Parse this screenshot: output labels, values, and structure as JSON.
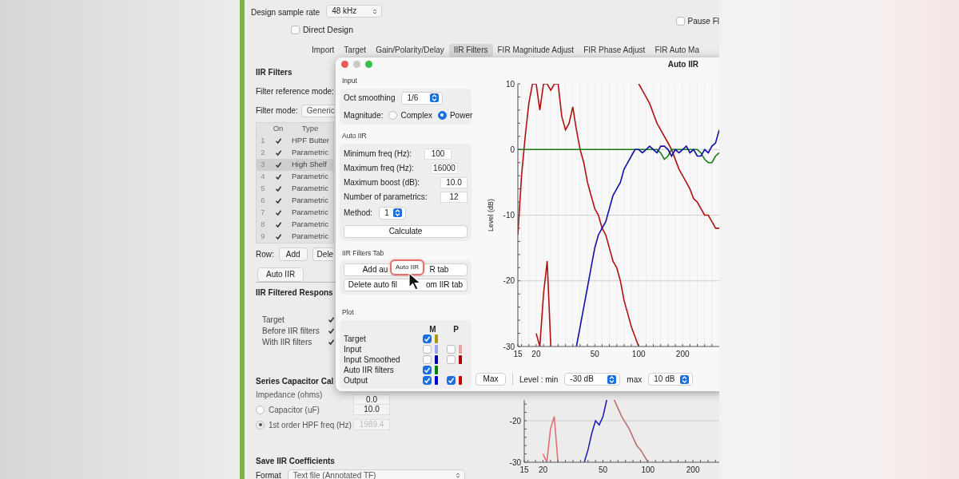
{
  "main_window": {
    "sample_rate": {
      "label": "Design sample rate",
      "value": "48 kHz"
    },
    "pause": {
      "label": "Pause Fl",
      "checked": false
    },
    "direct_design": {
      "label": "Direct Design",
      "checked": false
    },
    "tabs": [
      {
        "label": "Import",
        "selected": false
      },
      {
        "label": "Target",
        "selected": false
      },
      {
        "label": "Gain/Polarity/Delay",
        "selected": false
      },
      {
        "label": "IIR Filters",
        "selected": true
      },
      {
        "label": "FIR Magnitude Adjust",
        "selected": false
      },
      {
        "label": "FIR Phase Adjust",
        "selected": false
      },
      {
        "label": "FIR Auto Ma",
        "selected": false
      }
    ],
    "iir_panel": {
      "title": "IIR Filters",
      "reference_mode_label": "Filter reference mode:",
      "filter_mode_label": "Filter mode:",
      "filter_mode_value": "Generic",
      "table": {
        "columns": [
          "On",
          "Type"
        ],
        "rows": [
          {
            "index": "1",
            "on": true,
            "type": "HPF Butter",
            "selected": false
          },
          {
            "index": "2",
            "on": true,
            "type": "Parametric",
            "selected": false
          },
          {
            "index": "3",
            "on": true,
            "type": "High Shelf",
            "selected": true
          },
          {
            "index": "4",
            "on": true,
            "type": "Parametric",
            "selected": false
          },
          {
            "index": "5",
            "on": true,
            "type": "Parametric",
            "selected": false
          },
          {
            "index": "6",
            "on": true,
            "type": "Parametric",
            "selected": false
          },
          {
            "index": "7",
            "on": true,
            "type": "Parametric",
            "selected": false
          },
          {
            "index": "8",
            "on": true,
            "type": "Parametric",
            "selected": false
          },
          {
            "index": "9",
            "on": true,
            "type": "Parametric",
            "selected": false
          }
        ]
      },
      "row_label": "Row:",
      "add_button": "Add",
      "delete_button": "Dele",
      "auto_iir_button": "Auto IIR"
    },
    "response_panel": {
      "title": "IIR Filtered Respons",
      "rows": [
        {
          "label": "Target",
          "checked": true
        },
        {
          "label": "Before IIR filters",
          "checked": true
        },
        {
          "label": "With IIR filters",
          "checked": true
        }
      ]
    },
    "capacitor_panel": {
      "title": "Series Capacitor Cal",
      "impedance_label": "Impedance (ohms)",
      "impedance_value": "0.0",
      "options": [
        {
          "label": "Capacitor (uF)",
          "selected": false,
          "value": "10.0"
        },
        {
          "label": "1st order HPF freq (Hz)",
          "selected": true,
          "value": "1989.4"
        }
      ]
    },
    "save_panel": {
      "title": "Save IIR Coefficients",
      "format_label": "Format",
      "format_value": "Text file (Annotated TF)"
    },
    "background_chart": {
      "chart_data": {
        "type": "line",
        "grid": true,
        "categories": [
          "15",
          null,
          null,
          null,
          null,
          "20",
          null,
          null,
          null,
          null,
          null,
          null,
          null,
          null,
          null,
          null,
          null,
          null,
          null,
          null,
          null,
          "50",
          null,
          null,
          null,
          null,
          null,
          null,
          null,
          null,
          null,
          null,
          null,
          "100",
          null,
          null,
          null,
          null,
          null,
          null,
          null,
          null,
          null,
          null,
          null,
          "200",
          null,
          null,
          null,
          null,
          null,
          null,
          null
        ],
        "ylim": [
          -30,
          -15
        ],
        "yticks": [
          -20,
          -30
        ],
        "series": [
          {
            "color": "#2020b0",
            "values": [
              null,
              null,
              null,
              null,
              null,
              null,
              null,
              null,
              null,
              null,
              null,
              null,
              null,
              null,
              null,
              null,
              -30,
              -27,
              -23,
              -20,
              -21,
              -19,
              -15,
              null,
              null,
              null,
              null,
              null,
              null,
              null,
              null,
              null,
              null,
              null,
              null,
              null,
              null,
              null,
              null,
              null,
              null,
              null,
              null,
              null,
              null,
              null,
              null,
              null,
              null,
              null,
              null,
              null,
              null
            ]
          },
          {
            "color": "#b87070",
            "values": [
              null,
              null,
              null,
              null,
              null,
              null,
              null,
              null,
              null,
              null,
              null,
              null,
              null,
              null,
              null,
              null,
              null,
              null,
              null,
              null,
              null,
              null,
              null,
              null,
              -15,
              -17,
              -19,
              -20.5,
              -22,
              -24,
              -26,
              -27,
              -28.5,
              -30,
              null,
              null,
              null,
              null,
              null,
              null,
              null,
              null,
              null,
              null,
              null,
              null,
              null,
              null,
              null,
              null,
              null,
              null,
              null
            ]
          },
          {
            "color": "#e07070",
            "values": [
              null,
              null,
              null,
              null,
              null,
              -28,
              -30,
              -22,
              -19,
              -30,
              null,
              null,
              null,
              null,
              null,
              null,
              null,
              null,
              null,
              null,
              null,
              null,
              null,
              null,
              null,
              null,
              null,
              null,
              null,
              null,
              null,
              null,
              null,
              null,
              null,
              null,
              null,
              null,
              null,
              null,
              null,
              null,
              null,
              null,
              null,
              null,
              null,
              null,
              null,
              null,
              null,
              null,
              null
            ]
          }
        ]
      }
    }
  },
  "dialog": {
    "title": "Auto IIR",
    "input": {
      "title": "Input",
      "smoothing_label": "Oct smoothing",
      "smoothing_value": "1/6",
      "magnitude_label": "Magnitude:",
      "magnitude_options": [
        {
          "label": "Complex",
          "selected": false
        },
        {
          "label": "Power",
          "selected": true
        }
      ]
    },
    "auto_iir": {
      "title": "Auto IIR",
      "fields": [
        {
          "label": "Minimum freq (Hz):",
          "value": "100"
        },
        {
          "label": "Maximum freq (Hz):",
          "value": "16000"
        },
        {
          "label": "Maximum boost (dB):",
          "value": "10.0"
        },
        {
          "label": "Number of parametrics:",
          "value": "12"
        }
      ],
      "method_label": "Method:",
      "method_value": "1",
      "calculate_button": "Calculate"
    },
    "iir_tab": {
      "title": "IIR Filters Tab",
      "buttons": [
        {
          "parts": [
            "Add au",
            "R tab"
          ]
        },
        {
          "parts": [
            "Delete auto fil",
            "om IIR tab"
          ]
        }
      ]
    },
    "tooltip": "Auto IIR",
    "plot": {
      "title": "Plot",
      "columns": [
        "M",
        "P"
      ],
      "rows": [
        {
          "label": "Target",
          "m": {
            "checked": true,
            "color": "#a89a00"
          }
        },
        {
          "label": "Input",
          "m": {
            "checked": false,
            "color": "#a0a0f0"
          },
          "p": {
            "checked": false,
            "color": "#f0a0a0"
          }
        },
        {
          "label": "Input Smoothed",
          "m": {
            "checked": false,
            "color": "#0000a8"
          },
          "p": {
            "checked": false,
            "color": "#a80000"
          }
        },
        {
          "label": "Auto IIR filters",
          "m": {
            "checked": true,
            "color": "#008000"
          }
        },
        {
          "label": "Output",
          "m": {
            "checked": true,
            "color": "#0000c8"
          },
          "p": {
            "checked": true,
            "color": "#c80000"
          }
        }
      ]
    },
    "chart_data": {
      "type": "line",
      "grid": true,
      "ylabel": "Level (dB)",
      "categories": [
        "15",
        null,
        null,
        null,
        null,
        "20",
        null,
        null,
        null,
        null,
        null,
        null,
        null,
        null,
        null,
        null,
        null,
        null,
        null,
        null,
        null,
        "50",
        null,
        null,
        null,
        null,
        null,
        null,
        null,
        null,
        null,
        null,
        null,
        "100",
        null,
        null,
        null,
        null,
        null,
        null,
        null,
        null,
        null,
        null,
        null,
        "200",
        null,
        null,
        null,
        null,
        null,
        null,
        null,
        null,
        null,
        null
      ],
      "ylim": [
        -30,
        10
      ],
      "yticks": [
        10,
        0,
        -10,
        -20,
        -30
      ],
      "series": [
        {
          "color": "#b01010",
          "values": [
            -13,
            -4,
            2,
            7,
            10,
            10,
            6,
            10,
            10,
            9,
            10,
            10,
            5,
            3,
            4,
            6.5,
            3,
            0,
            -2,
            -5,
            -7,
            -9,
            -10,
            -12,
            -13,
            -15,
            -17,
            -18,
            -20,
            -23,
            -25,
            -27,
            -28.5,
            -30,
            null,
            null,
            null,
            null,
            null,
            null,
            null,
            null,
            null,
            null,
            null,
            null,
            null,
            null,
            null,
            null,
            null,
            null,
            null,
            null,
            null,
            null
          ]
        },
        {
          "color": "#b01010",
          "values": [
            null,
            null,
            null,
            null,
            null,
            null,
            null,
            null,
            null,
            null,
            null,
            null,
            null,
            null,
            null,
            null,
            null,
            null,
            null,
            null,
            null,
            null,
            null,
            null,
            null,
            null,
            null,
            null,
            null,
            null,
            null,
            null,
            null,
            10,
            9,
            8,
            7,
            5.5,
            4,
            3,
            2,
            1,
            0,
            -1.5,
            -3,
            -4,
            -5,
            -6,
            -7.5,
            -8,
            -9,
            -10,
            -10,
            -11,
            -12,
            -12
          ]
        },
        {
          "color": "#b01010",
          "values": [
            null,
            null,
            null,
            null,
            null,
            -28,
            -30,
            -22,
            -17,
            -30,
            null,
            null,
            null,
            null,
            null,
            null,
            null,
            null,
            null,
            null,
            null,
            null,
            null,
            null,
            null,
            null,
            null,
            null,
            null,
            null,
            null,
            null,
            null,
            null,
            null,
            null,
            null,
            null,
            null,
            null,
            null,
            null,
            null,
            null,
            null,
            null,
            null,
            null,
            null,
            null,
            null,
            null,
            null,
            null,
            null,
            null
          ]
        },
        {
          "color": "#1a7a1a",
          "values": [
            0,
            0,
            0,
            0,
            0,
            0,
            0,
            0,
            0,
            0,
            0,
            0,
            0,
            0,
            0,
            0,
            0,
            0,
            0,
            0,
            0,
            0,
            0,
            0,
            0,
            0,
            0,
            0,
            0,
            0,
            0,
            0,
            0,
            0,
            0,
            0,
            0,
            0,
            0,
            -0.5,
            -1.5,
            -1,
            0,
            0,
            0,
            0,
            0,
            0,
            0,
            0,
            -0.5,
            -1.5,
            -2,
            -2,
            -1,
            -0.5
          ]
        },
        {
          "color": "#1010a8",
          "values": [
            null,
            null,
            null,
            null,
            null,
            null,
            null,
            null,
            null,
            null,
            null,
            null,
            null,
            null,
            null,
            null,
            -30,
            -27,
            -24,
            -21,
            -18,
            -15,
            -13,
            -12,
            -11,
            -9,
            -7,
            -6,
            -5,
            -3,
            -2,
            -1,
            0,
            0,
            -0.5,
            0,
            0.5,
            0,
            -0.5,
            0.5,
            0.5,
            0,
            -1,
            0,
            -0.5,
            0,
            0.5,
            -0.5,
            0,
            -1,
            -1,
            0,
            -0.5,
            0.5,
            1,
            3
          ]
        }
      ]
    },
    "controls": {
      "max_button": "Max",
      "min_label": "Level : min",
      "min_value": "-30 dB",
      "max_label": "max",
      "max_value": "10 dB"
    }
  }
}
